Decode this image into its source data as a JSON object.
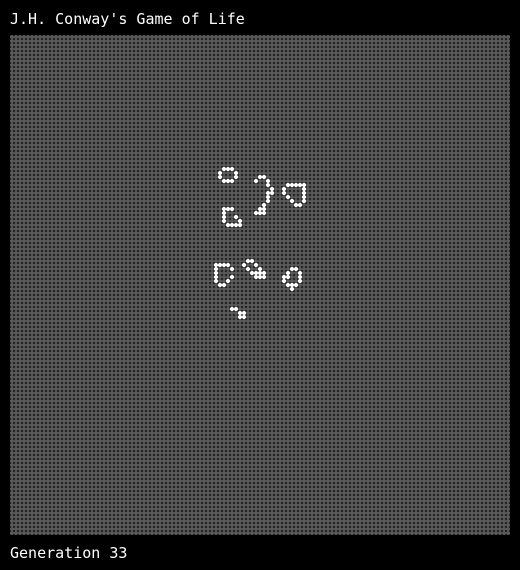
{
  "window": {
    "title": "J.H. Conway's Game of Life"
  },
  "status": {
    "generation_text": "Generation 33"
  },
  "board": {
    "cols": 125,
    "rows": 125,
    "dead_color": "#5a5a5a",
    "alive_color": "#ffffff",
    "background_color": "#000000",
    "live_cells": [
      [
        53,
        33
      ],
      [
        54,
        33
      ],
      [
        55,
        33
      ],
      [
        52,
        34
      ],
      [
        56,
        34
      ],
      [
        52,
        35
      ],
      [
        56,
        35
      ],
      [
        53,
        36
      ],
      [
        54,
        36
      ],
      [
        55,
        36
      ],
      [
        62,
        35
      ],
      [
        63,
        35
      ],
      [
        61,
        36
      ],
      [
        64,
        36
      ],
      [
        64,
        37
      ],
      [
        65,
        38
      ],
      [
        64,
        39
      ],
      [
        65,
        39
      ],
      [
        64,
        40
      ],
      [
        64,
        41
      ],
      [
        63,
        42
      ],
      [
        62,
        43
      ],
      [
        63,
        43
      ],
      [
        61,
        44
      ],
      [
        62,
        44
      ],
      [
        63,
        44
      ],
      [
        69,
        37
      ],
      [
        70,
        37
      ],
      [
        71,
        37
      ],
      [
        72,
        37
      ],
      [
        73,
        37
      ],
      [
        68,
        38
      ],
      [
        73,
        38
      ],
      [
        68,
        39
      ],
      [
        73,
        39
      ],
      [
        69,
        40
      ],
      [
        73,
        40
      ],
      [
        70,
        41
      ],
      [
        73,
        41
      ],
      [
        71,
        42
      ],
      [
        72,
        42
      ],
      [
        53,
        43
      ],
      [
        54,
        43
      ],
      [
        55,
        43
      ],
      [
        53,
        44
      ],
      [
        53,
        45
      ],
      [
        56,
        45
      ],
      [
        53,
        46
      ],
      [
        57,
        46
      ],
      [
        54,
        47
      ],
      [
        55,
        47
      ],
      [
        56,
        47
      ],
      [
        57,
        47
      ],
      [
        51,
        57
      ],
      [
        52,
        57
      ],
      [
        53,
        57
      ],
      [
        54,
        57
      ],
      [
        51,
        58
      ],
      [
        55,
        58
      ],
      [
        51,
        59
      ],
      [
        51,
        60
      ],
      [
        55,
        60
      ],
      [
        51,
        61
      ],
      [
        54,
        61
      ],
      [
        52,
        62
      ],
      [
        53,
        62
      ],
      [
        59,
        56
      ],
      [
        60,
        56
      ],
      [
        58,
        57
      ],
      [
        61,
        57
      ],
      [
        59,
        58
      ],
      [
        62,
        58
      ],
      [
        60,
        59
      ],
      [
        61,
        59
      ],
      [
        62,
        59
      ],
      [
        63,
        59
      ],
      [
        61,
        60
      ],
      [
        62,
        60
      ],
      [
        63,
        60
      ],
      [
        70,
        58
      ],
      [
        71,
        58
      ],
      [
        69,
        59
      ],
      [
        72,
        59
      ],
      [
        68,
        60
      ],
      [
        69,
        60
      ],
      [
        72,
        60
      ],
      [
        68,
        61
      ],
      [
        72,
        61
      ],
      [
        69,
        62
      ],
      [
        70,
        62
      ],
      [
        71,
        62
      ],
      [
        70,
        63
      ],
      [
        55,
        68
      ],
      [
        56,
        68
      ],
      [
        57,
        69
      ],
      [
        58,
        69
      ],
      [
        57,
        70
      ],
      [
        58,
        70
      ]
    ]
  }
}
